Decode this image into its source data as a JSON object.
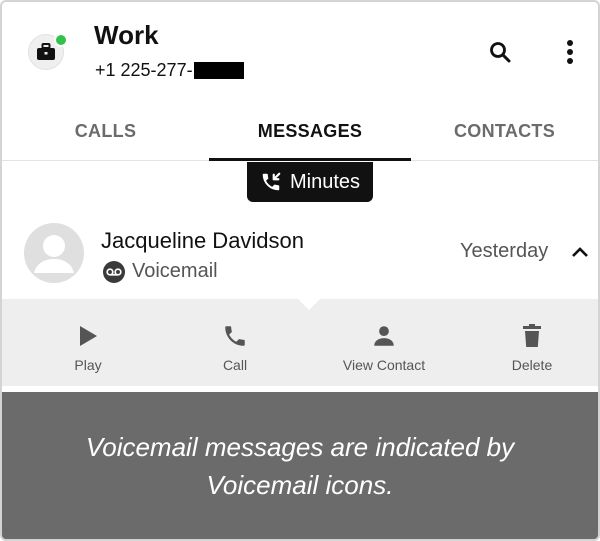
{
  "header": {
    "account_name": "Work",
    "phone_number": "+1 225-277-",
    "status_color": "#33c14b",
    "account_icon": "briefcase-icon",
    "actions": [
      "search-icon",
      "more-vert-icon"
    ]
  },
  "tabs": [
    {
      "label": "CALLS",
      "active": false
    },
    {
      "label": "MESSAGES",
      "active": true
    },
    {
      "label": "CONTACTS",
      "active": false
    }
  ],
  "minutes_badge": {
    "label": "Minutes",
    "icon": "phone-incoming-icon"
  },
  "message": {
    "contact_name": "Jacqueline Davidson",
    "type_label": "Voicemail",
    "type_icon": "voicemail-icon",
    "time": "Yesterday",
    "expanded": true
  },
  "actions": [
    {
      "label": "Play",
      "icon": "play-icon"
    },
    {
      "label": "Call",
      "icon": "phone-icon"
    },
    {
      "label": "View Contact",
      "icon": "person-icon"
    },
    {
      "label": "Delete",
      "icon": "trash-icon"
    }
  ],
  "overlay": {
    "text": "Voicemail messages are indicated by Voicemail icons."
  },
  "colors": {
    "accent": "#111111",
    "action_bar_bg": "#eeeeee",
    "overlay_bg": "#6b6b6b"
  }
}
